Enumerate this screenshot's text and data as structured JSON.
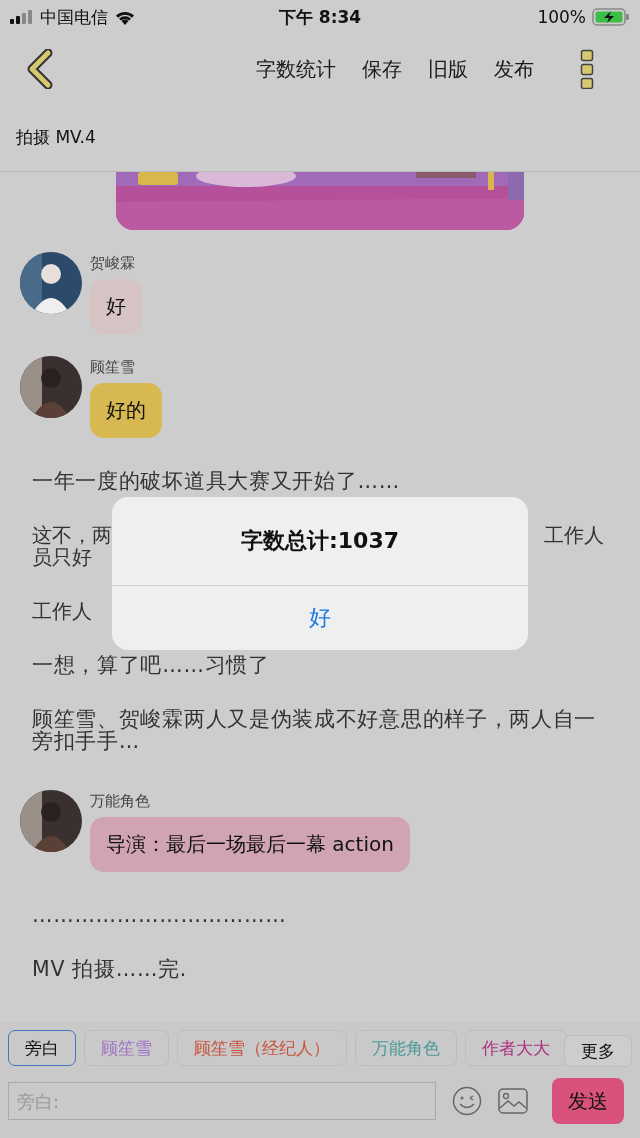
{
  "status_bar": {
    "carrier": "中国电信",
    "time": "下午 8:34",
    "battery": "100%"
  },
  "nav": {
    "actions": [
      "字数统计",
      "保存",
      "旧版",
      "发布"
    ]
  },
  "title": "拍摄 MV.4",
  "feed": [
    {
      "kind": "picture"
    },
    {
      "kind": "message",
      "name": "贺峻霖",
      "text": "好",
      "color": "#d6c4c4"
    },
    {
      "kind": "message",
      "name": "顾笙雪",
      "text": "好的",
      "color": "#d8b850"
    },
    {
      "kind": "text",
      "text": "一年一度的破坏道具大赛又开始了……"
    },
    {
      "kind": "covered",
      "lines": [
        {
          "left": "这不，两",
          "right": "工作人"
        },
        {
          "left": "员只好"
        }
      ]
    },
    {
      "kind": "covered",
      "lines": [
        {
          "left": "工作人"
        }
      ]
    },
    {
      "kind": "text",
      "text": "一想，算了吧……习惯了"
    },
    {
      "kind": "text",
      "text": "顾笙雪、贺峻霖两人又是伪装成不好意思的样子，两人自一旁扣手手…"
    },
    {
      "kind": "message",
      "name": "万能角色",
      "text": "导演：最后一场最后一幕 action",
      "color": "#d0a4b0"
    },
    {
      "kind": "text",
      "text": "………………………………"
    },
    {
      "kind": "text",
      "text": "MV 拍摄……完."
    }
  ],
  "roles": [
    {
      "label": "旁白",
      "selected": true,
      "color": "#111111"
    },
    {
      "label": "顾笙雪",
      "selected": false,
      "color": "#a070c8"
    },
    {
      "label": "顾笙雪（经纪人）",
      "selected": false,
      "color": "#c8503c"
    },
    {
      "label": "万能角色",
      "selected": false,
      "color": "#4a9a9a"
    },
    {
      "label": "作者大大",
      "selected": false,
      "color": "#b03080"
    }
  ],
  "more_button": "更多",
  "input": {
    "placeholder": "旁白:"
  },
  "send_button": "发送",
  "alert": {
    "title": "字数总计:1037",
    "button": "好"
  }
}
